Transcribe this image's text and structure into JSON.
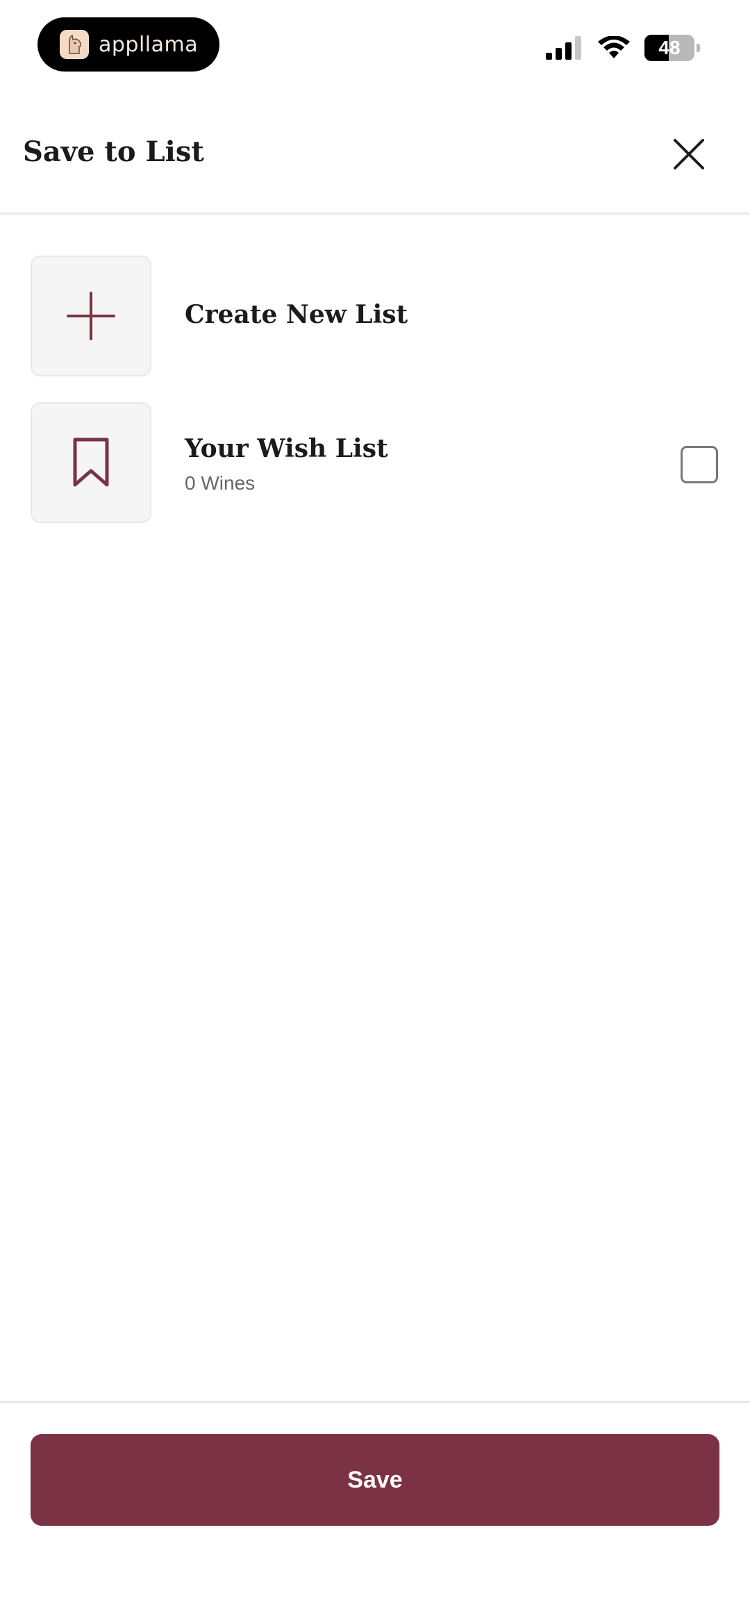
{
  "status_bar": {
    "app_badge": "appllama",
    "battery_percent": "48",
    "battery_level": 0.48,
    "signal_icon": "cellular-signal-icon",
    "wifi_icon": "wifi-icon"
  },
  "header": {
    "title": "Save to List",
    "close_icon": "close-icon"
  },
  "lists": {
    "create": {
      "label": "Create New List",
      "icon": "plus-icon"
    },
    "items": [
      {
        "name": "Your Wish List",
        "count_label": "0 Wines",
        "checked": false,
        "icon": "bookmark-icon"
      }
    ]
  },
  "footer": {
    "save_label": "Save"
  },
  "colors": {
    "accent": "#7a3244",
    "tile_bg": "#f5f5f5",
    "divider": "#e9e9e9"
  }
}
